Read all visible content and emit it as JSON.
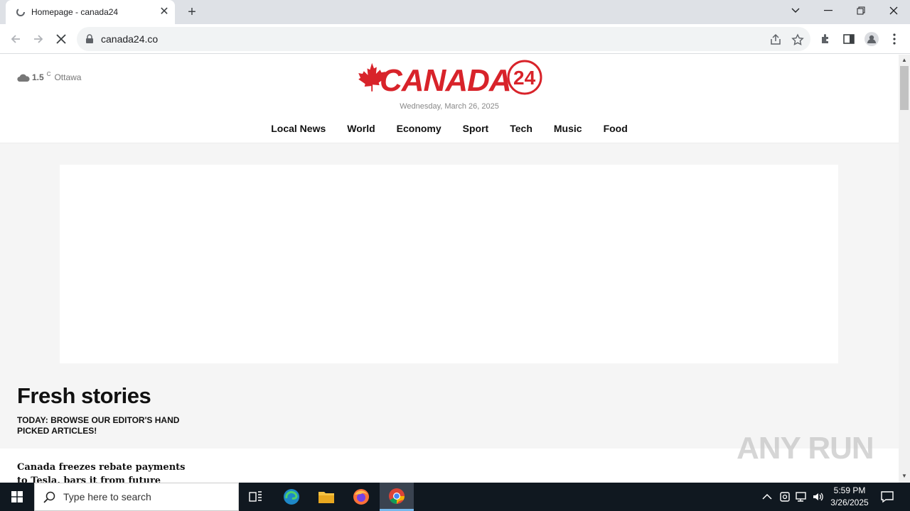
{
  "browser": {
    "tab_title": "Homepage - canada24",
    "url": "canada24.co"
  },
  "site": {
    "logo_text": "CANADA",
    "logo_number": "24",
    "weather": {
      "temp": "1.5",
      "unit": "C",
      "city": "Ottawa"
    },
    "date": "Wednesday, March 26, 2025",
    "menu": [
      "Local News",
      "World",
      "Economy",
      "Sport",
      "Tech",
      "Music",
      "Food"
    ],
    "section_title": "Fresh stories",
    "section_subtitle": "TODAY: BROWSE OUR EDITOR'S HAND PICKED ARTICLES!",
    "article_title": "Canada freezes rebate payments to Tesla, bars it from future"
  },
  "watermark": "ANY RUN",
  "taskbar": {
    "search_placeholder": "Type here to search",
    "time": "5:59 PM",
    "date": "3/26/2025"
  },
  "colors": {
    "brand_red": "#d8232a",
    "taskbar": "#101820"
  }
}
